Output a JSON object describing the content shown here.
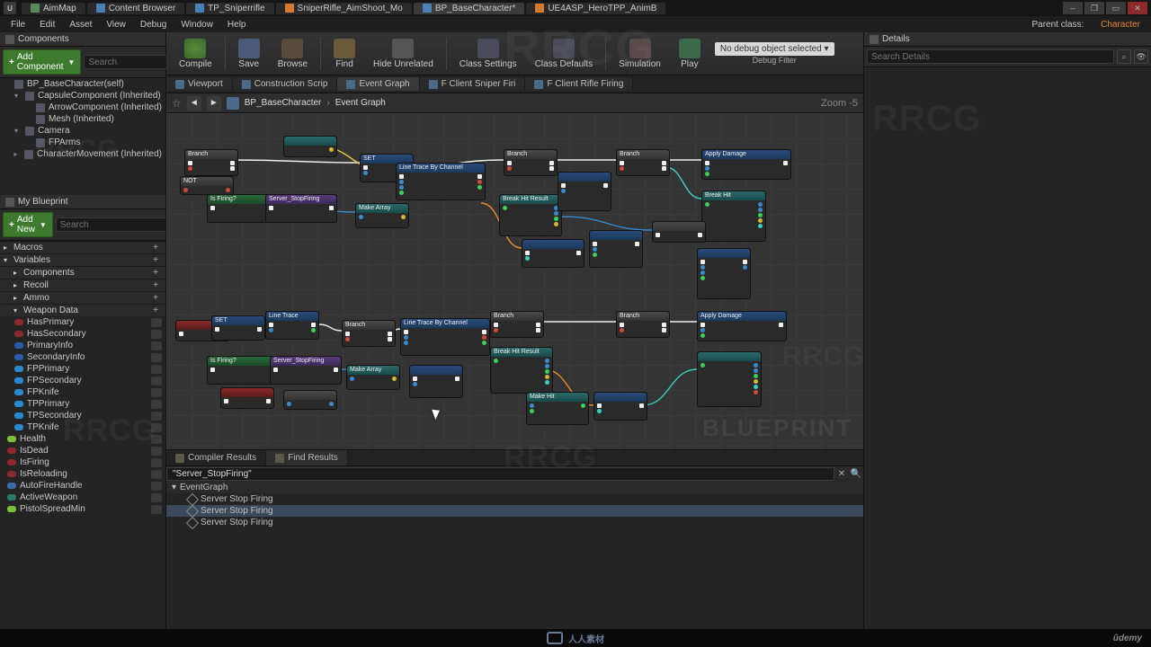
{
  "titlebar": {
    "tabs": [
      {
        "label": "AimMap",
        "kind": "world"
      },
      {
        "label": "Content Browser",
        "kind": "bp"
      },
      {
        "label": "TP_Sniperrifle",
        "kind": "bp"
      },
      {
        "label": "SniperRifle_AimShoot_Mo",
        "kind": "anim"
      },
      {
        "label": "BP_BaseCharacter*",
        "kind": "bp",
        "active": true
      },
      {
        "label": "UE4ASP_HeroTPP_AnimB",
        "kind": "anim"
      }
    ],
    "win": {
      "min": "–",
      "max": "▭",
      "restore": "❐",
      "close": "✕"
    }
  },
  "menu": {
    "items": [
      "File",
      "Edit",
      "Asset",
      "View",
      "Debug",
      "Window",
      "Help"
    ],
    "parent_label": "Parent class:",
    "parent_value": "Character"
  },
  "components": {
    "title": "Components",
    "add_btn": "Add Component",
    "search_ph": "Search",
    "tree": [
      {
        "label": "BP_BaseCharacter(self)",
        "depth": 0
      },
      {
        "label": "CapsuleComponent (Inherited)",
        "depth": 1,
        "arrow": "▾"
      },
      {
        "label": "ArrowComponent (Inherited)",
        "depth": 2
      },
      {
        "label": "Mesh (Inherited)",
        "depth": 2
      },
      {
        "label": "Camera",
        "depth": 1,
        "arrow": "▾"
      },
      {
        "label": "FPArms",
        "depth": 2
      },
      {
        "label": "CharacterMovement (Inherited)",
        "depth": 1,
        "arrow": "▸"
      }
    ]
  },
  "myblueprint": {
    "title": "My Blueprint",
    "add_btn": "Add New",
    "search_ph": "Search",
    "sections": [
      {
        "label": "Macros"
      },
      {
        "label": "Variables",
        "arrow": "▾"
      },
      {
        "label": "Components",
        "indent": true
      },
      {
        "label": "Recoil",
        "indent": true
      },
      {
        "label": "Ammo",
        "indent": true
      },
      {
        "label": "Weapon Data",
        "indent": true,
        "arrow": "▾"
      }
    ],
    "weapon_vars": [
      {
        "label": "HasPrimary",
        "color": "#8a2a2a"
      },
      {
        "label": "HasSecondary",
        "color": "#8a2a2a"
      },
      {
        "label": "PrimaryInfo",
        "color": "#2a5aaa"
      },
      {
        "label": "SecondaryInfo",
        "color": "#2a5aaa"
      },
      {
        "label": "FPPrimary",
        "color": "#2a8ad0"
      },
      {
        "label": "FPSecondary",
        "color": "#2a8ad0"
      },
      {
        "label": "FPKnife",
        "color": "#2a8ad0"
      },
      {
        "label": "TPPrimary",
        "color": "#2a8ad0"
      },
      {
        "label": "TPSecondary",
        "color": "#2a8ad0"
      },
      {
        "label": "TPKnife",
        "color": "#2a8ad0"
      }
    ],
    "more_vars": [
      {
        "label": "Health",
        "color": "#7ac03a"
      },
      {
        "label": "IsDead",
        "color": "#8a2a2a"
      },
      {
        "label": "IsFiring",
        "color": "#8a2a2a"
      },
      {
        "label": "IsReloading",
        "color": "#8a2a2a"
      },
      {
        "label": "AutoFireHandle",
        "color": "#3a6aaa"
      },
      {
        "label": "ActiveWeapon",
        "color": "#2a7a6a"
      },
      {
        "label": "PistolSpreadMin",
        "color": "#7ac03a"
      }
    ]
  },
  "toolbar": {
    "compile": "Compile",
    "save": "Save",
    "browse": "Browse",
    "find": "Find",
    "hide": "Hide Unrelated",
    "cls_set": "Class Settings",
    "cls_def": "Class Defaults",
    "sim": "Simulation",
    "play": "Play",
    "debug_sel": "No debug object selected ▾",
    "debug_label": "Debug Filter"
  },
  "graph_tabs": [
    {
      "label": "Viewport"
    },
    {
      "label": "Construction Scrip"
    },
    {
      "label": "Event Graph",
      "active": true
    },
    {
      "label": "F Client Sniper Firi"
    },
    {
      "label": "F Client Rifle Firing"
    }
  ],
  "breadcrumb": {
    "a": "BP_BaseCharacter",
    "b": "Event Graph",
    "zoom": "Zoom  -5"
  },
  "watermark": "BLUEPRINT",
  "bottom_tabs": [
    {
      "label": "Compiler Results"
    },
    {
      "label": "Find Results",
      "active": true
    }
  ],
  "find": {
    "query": "\"Server_StopFiring\""
  },
  "results": [
    {
      "label": "EventGraph",
      "group": true
    },
    {
      "label": "Server Stop Firing"
    },
    {
      "label": "Server Stop Firing",
      "sel": true
    },
    {
      "label": "Server Stop Firing"
    }
  ],
  "details": {
    "title": "Details",
    "search_ph": "Search Details"
  },
  "footer": {
    "label": "人人素材",
    "udemy": "ûdemy"
  },
  "overlay": "RRCG",
  "colors": {
    "exec": "#f0f0f0",
    "bool": "#8a2a2a",
    "int": "#1fb59a",
    "float": "#9fe55a",
    "obj": "#2a8ad0",
    "struct": "#0a3a8a"
  }
}
